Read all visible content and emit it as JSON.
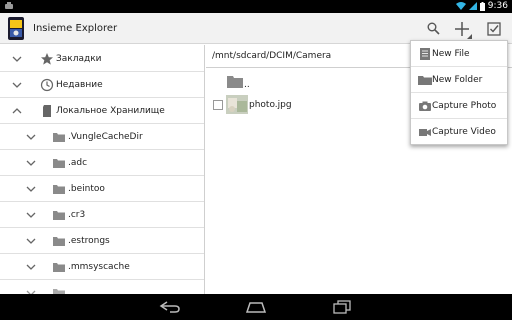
{
  "status_bar": {
    "time": "9:36"
  },
  "app": {
    "title": "Insieme Explorer"
  },
  "toolbar": {
    "search_icon": "search-icon",
    "add_icon": "plus-icon",
    "select_icon": "checkbox-icon"
  },
  "tree": {
    "items": [
      {
        "label": "Закладки",
        "icon": "star-icon",
        "expanded": false
      },
      {
        "label": "Недавние",
        "icon": "clock-icon",
        "expanded": false
      },
      {
        "label": "Локальное Хранилище",
        "icon": "sdcard-icon",
        "expanded": true
      },
      {
        "label": ".VungleCacheDir",
        "icon": "folder-icon",
        "expanded": false
      },
      {
        "label": ".adc",
        "icon": "folder-icon",
        "expanded": false
      },
      {
        "label": ".beintoo",
        "icon": "folder-icon",
        "expanded": false
      },
      {
        "label": ".cr3",
        "icon": "folder-icon",
        "expanded": false
      },
      {
        "label": ".estrongs",
        "icon": "folder-icon",
        "expanded": false
      },
      {
        "label": ".mmsyscache",
        "icon": "folder-icon",
        "expanded": false
      }
    ]
  },
  "files": {
    "path": "/mnt/sdcard/DCIM/Camera",
    "parent_label": "..",
    "items": [
      {
        "name": "photo.jpg",
        "checked": false
      }
    ]
  },
  "menu": {
    "items": [
      {
        "label": "New File",
        "icon": "file-icon"
      },
      {
        "label": "New Folder",
        "icon": "folder-icon"
      },
      {
        "label": "Capture Photo",
        "icon": "camera-icon"
      },
      {
        "label": "Capture Video",
        "icon": "video-camera-icon"
      }
    ]
  },
  "colors": {
    "status_bar": "#000000",
    "action_bar": "#f2f2f2",
    "folder": "#8a8a8a",
    "accent": "#33b5e5"
  }
}
